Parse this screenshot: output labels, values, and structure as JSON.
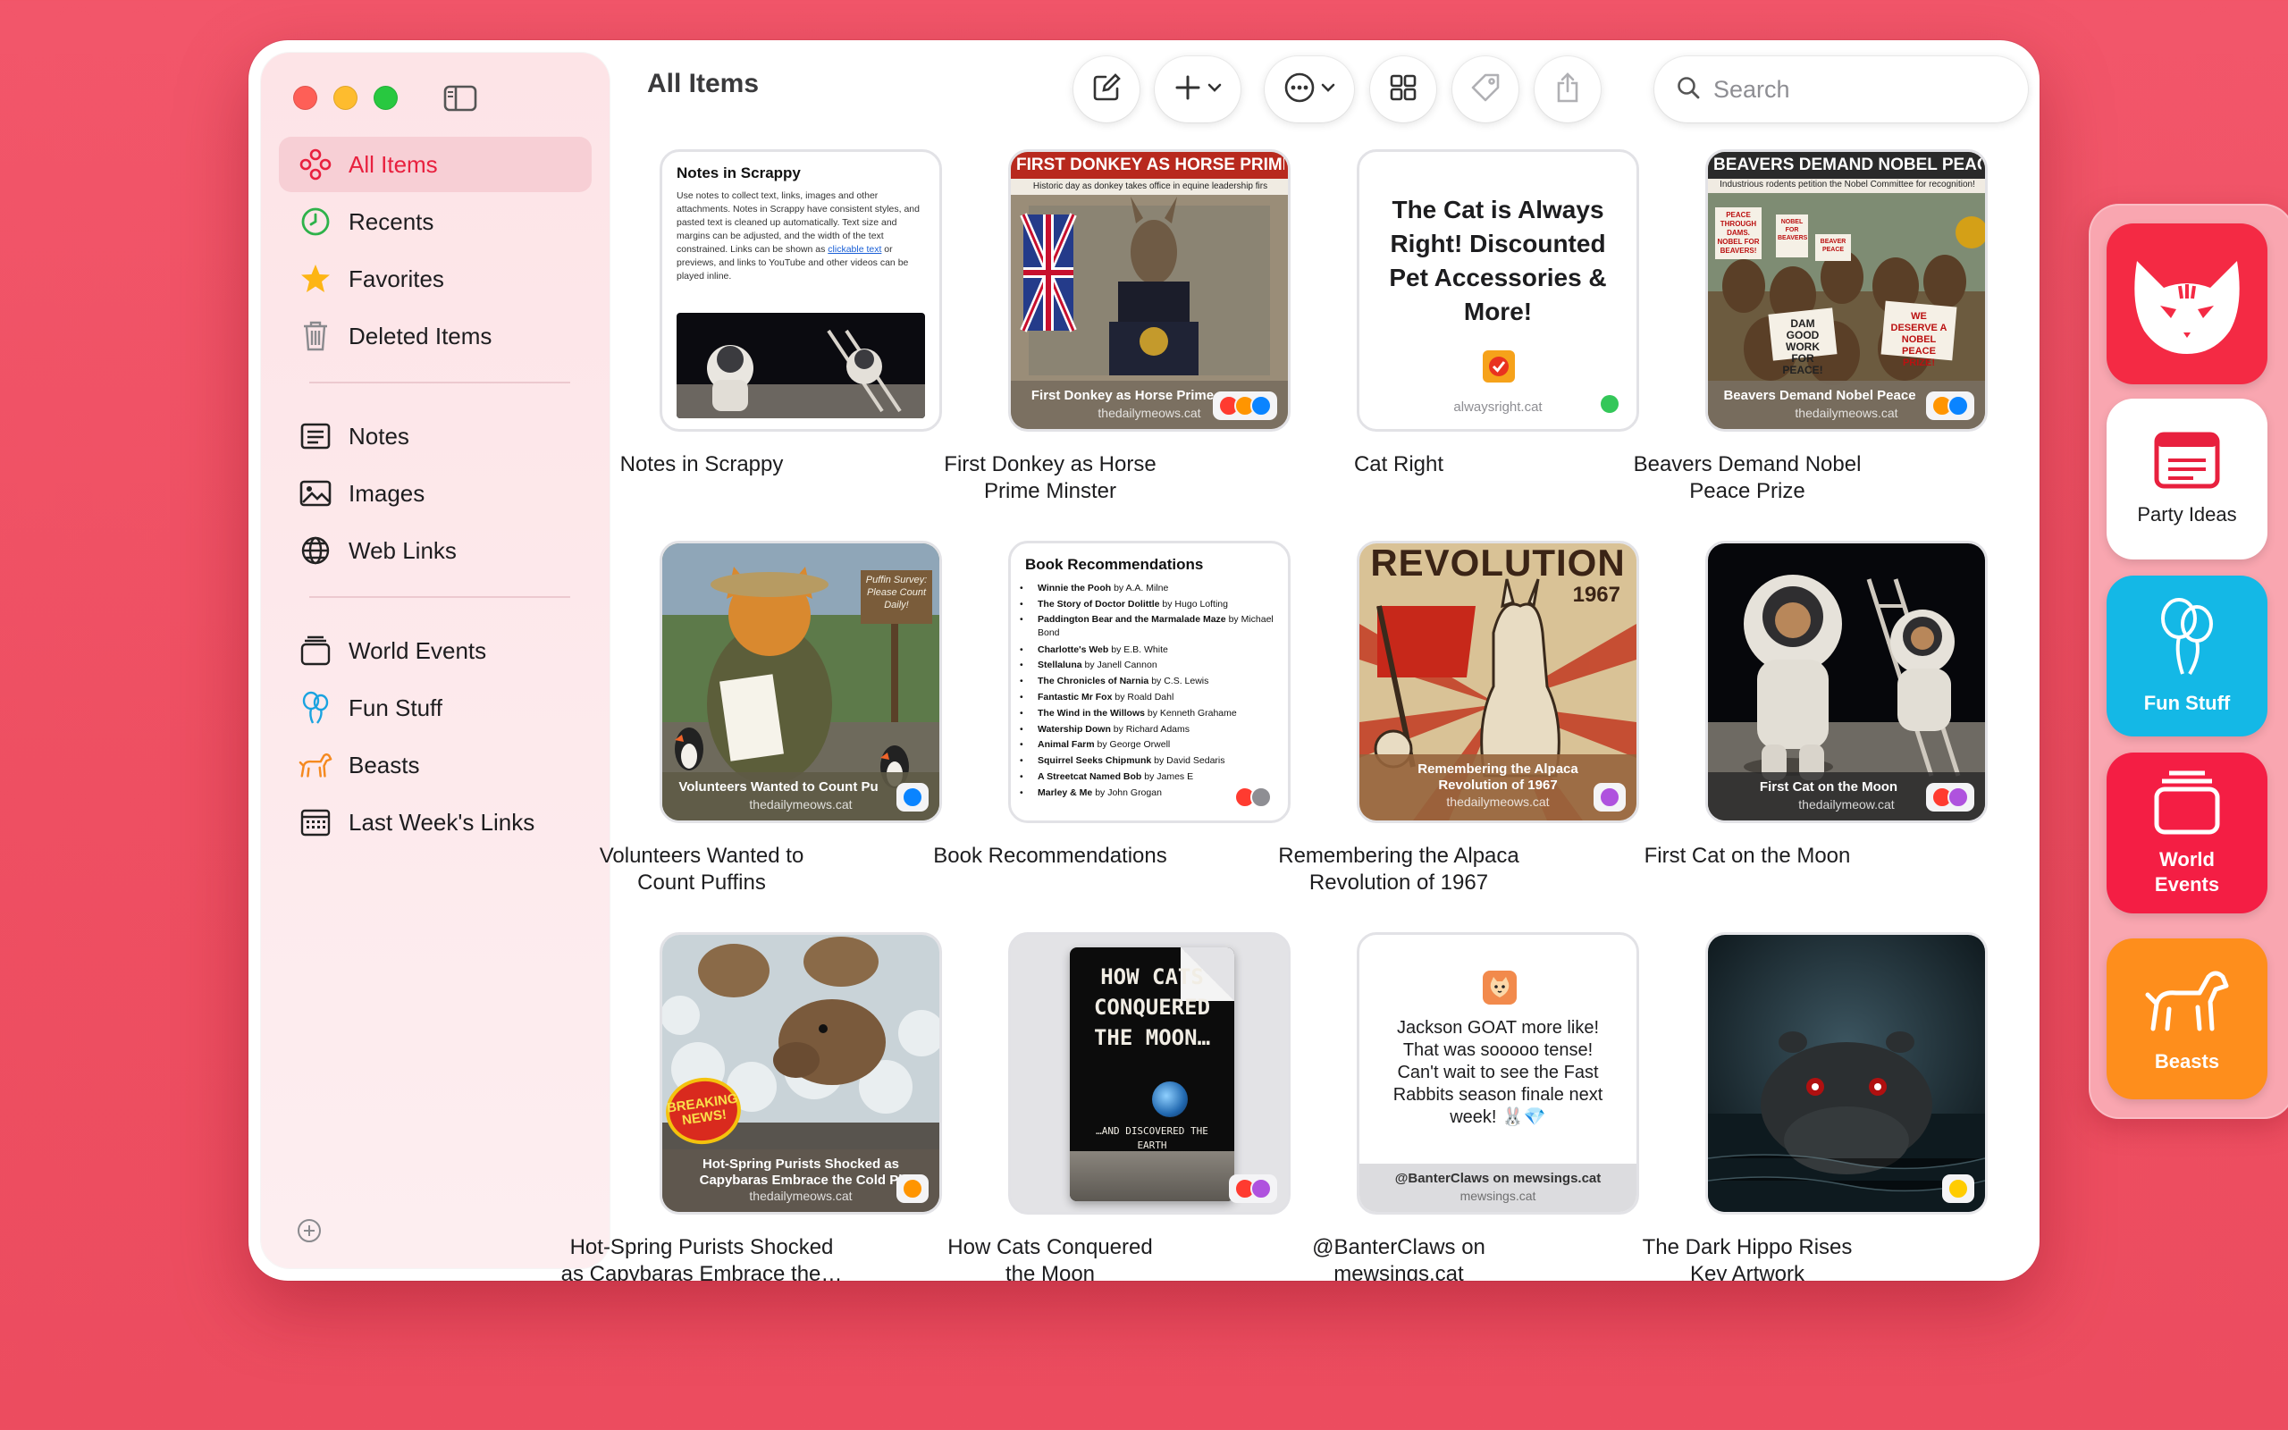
{
  "window": {
    "title": "All Items"
  },
  "sidebar": {
    "library": [
      {
        "label": "All Items",
        "icon": "all-items-icon",
        "active": true
      },
      {
        "label": "Recents",
        "icon": "clock-icon"
      },
      {
        "label": "Favorites",
        "icon": "star-icon"
      },
      {
        "label": "Deleted Items",
        "icon": "trash-icon"
      }
    ],
    "types": [
      {
        "label": "Notes",
        "icon": "note-icon"
      },
      {
        "label": "Images",
        "icon": "image-icon"
      },
      {
        "label": "Web Links",
        "icon": "globe-icon"
      }
    ],
    "collections": [
      {
        "label": "World Events",
        "icon": "stack-icon"
      },
      {
        "label": "Fun Stuff",
        "icon": "balloons-icon"
      },
      {
        "label": "Beasts",
        "icon": "dog-icon"
      },
      {
        "label": "Last Week's Links",
        "icon": "calendar-icon"
      }
    ]
  },
  "toolbar": {
    "search_placeholder": "Search"
  },
  "items": [
    {
      "caption": [
        "Notes in Scrappy"
      ],
      "type": "note",
      "note_title": "Notes in Scrappy",
      "note_text_before_link": "Use notes to collect text, links, images and other attachments. Notes in Scrappy have consistent styles, and pasted text is cleaned up automatically. Text size and margins can be adjusted, and the width of the text constrained. Links can be shown as ",
      "note_link": "clickable text",
      "note_text_after_link": " or previews, and links to YouTube and other videos can be played inline."
    },
    {
      "caption": [
        "First Donkey as Horse",
        "Prime Minster"
      ],
      "type": "link",
      "headline": "FIRST DONKEY AS HORSE PRIME M",
      "subhead": "Historic day as donkey takes office in equine leadership firs",
      "overlay_title": "First Donkey as Horse Prime",
      "overlay_domain": "thedailymeows.cat",
      "dots": [
        "#ff3b30",
        "#ff9500",
        "#0a84ff"
      ]
    },
    {
      "caption": [
        "Cat Right"
      ],
      "type": "site",
      "headline_text": "The Cat is Always Right! Discounted Pet Accessories & More!",
      "domain": "alwaysright.cat",
      "dots": [
        "#34c759"
      ]
    },
    {
      "caption": [
        "Beavers Demand Nobel",
        "Peace Prize"
      ],
      "type": "link",
      "headline": "BEAVERS DEMAND NOBEL PEACE PR",
      "subhead": "Industrious rodents petition the Nobel Committee for recognition!",
      "overlay_title": "Beavers Demand Nobel Peace",
      "overlay_domain": "thedailymeows.cat",
      "dots": [
        "#ff9500",
        "#0a84ff"
      ],
      "signs": [
        "PEACE THROUGH DAMS. NOBEL FOR BEAVERS!",
        "NOBEL FOR BEAVERS",
        "BEAVER PEACE",
        "DAM GOOD WORK FOR PEACE!",
        "WE DESERVE A NOBEL PEACE PRIZE!"
      ]
    },
    {
      "caption": [
        "Volunteers Wanted to",
        "Count Puffins"
      ],
      "type": "link",
      "sign": "Puffin Survey: Please Count Daily!",
      "overlay_title": "Volunteers Wanted to Count Pu",
      "overlay_domain": "thedailymeows.cat",
      "dots": [
        "#0a84ff"
      ]
    },
    {
      "caption": [
        "Book Recommendations"
      ],
      "type": "note",
      "note_title": "Book Recommendations",
      "books": [
        {
          "title": "Winnie the Pooh",
          "author": "by A.A. Milne"
        },
        {
          "title": "The Story of Doctor Dolittle",
          "author": "by Hugo Lofting"
        },
        {
          "title": "Paddington Bear and the Marmalade Maze",
          "author": "by Michael Bond"
        },
        {
          "title": "Charlotte's Web",
          "author": "by E.B. White"
        },
        {
          "title": "Stellaluna",
          "author": "by Janell Cannon"
        },
        {
          "title": "The Chronicles of Narnia",
          "author": "by C.S. Lewis"
        },
        {
          "title": "Fantastic Mr Fox",
          "author": "by Roald Dahl"
        },
        {
          "title": "The Wind in the Willows",
          "author": "by Kenneth Grahame"
        },
        {
          "title": "Watership Down",
          "author": "by Richard Adams"
        },
        {
          "title": "Animal Farm",
          "author": "by George Orwell"
        },
        {
          "title": "Squirrel Seeks Chipmunk",
          "author": "by David Sedaris"
        },
        {
          "title": "A Streetcat Named Bob",
          "author": "by James E"
        },
        {
          "title": "Marley & Me",
          "author": "by John Grogan"
        }
      ],
      "dots": [
        "#ff3b30",
        "#8e8e93"
      ]
    },
    {
      "caption": [
        "Remembering the Alpaca",
        "Revolution of 1967"
      ],
      "type": "link",
      "headline": "REVOLUTION",
      "year": "1967",
      "overlay_title": "Remembering the Alpaca Revolution of 1967",
      "overlay_domain": "thedailymeows.cat",
      "dots": [
        "#af52de"
      ]
    },
    {
      "caption": [
        "First Cat on the Moon"
      ],
      "type": "link",
      "overlay_title": "First Cat on the Moon",
      "overlay_domain": "thedailymeow.cat",
      "dots": [
        "#ff3b30",
        "#af52de"
      ]
    },
    {
      "caption": [
        "Hot-Spring Purists Shocked",
        "as Capybaras Embrace the…"
      ],
      "type": "link",
      "badge": "BREAKING NEWS!",
      "overlay_title": "Hot-Spring Purists Shocked as Capybaras Embrace the Cold Pl",
      "overlay_domain": "thedailymeows.cat",
      "dots": [
        "#ff9500"
      ]
    },
    {
      "caption": [
        "How Cats Conquered",
        "the Moon"
      ],
      "type": "document",
      "book_title": "HOW CATS CONQUERED THE MOON…",
      "book_sub": "…AND DISCOVERED THE EARTH",
      "dots": [
        "#ff3b30",
        "#af52de"
      ]
    },
    {
      "caption": [
        "@BanterClaws on",
        "mewsings.cat"
      ],
      "type": "post",
      "post_text": "Jackson GOAT more like! That was sooooo tense! Can't wait to see the Fast Rabbits season finale next week! 🐰💎",
      "overlay_title": "@BanterClaws on mewsings.cat",
      "overlay_domain": "mewsings.cat"
    },
    {
      "caption": [
        "The Dark Hippo Rises",
        "Key Artwork"
      ],
      "type": "image",
      "dots": [
        "#ffcc00"
      ]
    }
  ],
  "dock": [
    {
      "label": "",
      "icon": "scrappy-cat-logo",
      "color": "#f42a44"
    },
    {
      "label": "Party Ideas",
      "icon": "browser-window-icon",
      "color": "#ffffff"
    },
    {
      "label": "Fun Stuff",
      "icon": "balloons-icon",
      "color": "#14b8e6"
    },
    {
      "label": "World Events",
      "icon": "stack-icon",
      "color": "#f41e44"
    },
    {
      "label": "Beasts",
      "icon": "dog-icon",
      "color": "#fe8e1c"
    }
  ],
  "colors": {
    "accent": "#e8203e",
    "background": "#ef5266",
    "sidebar": "#fde4e7"
  }
}
